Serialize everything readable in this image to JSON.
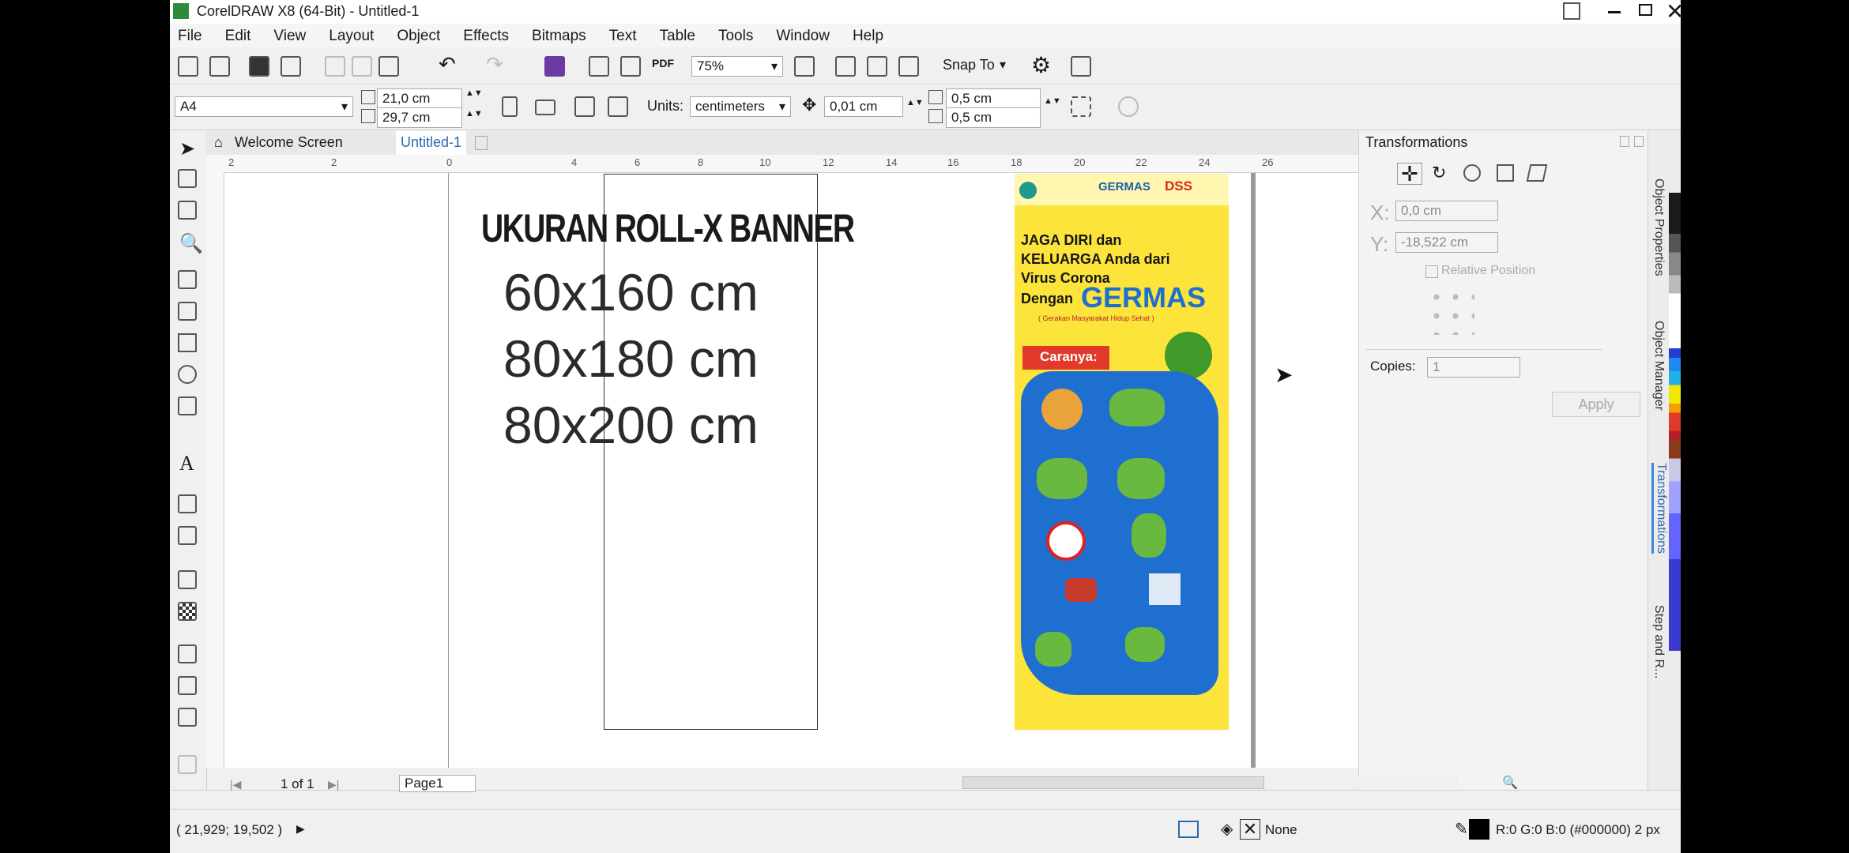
{
  "window": {
    "title": "CorelDRAW X8 (64-Bit) - Untitled-1"
  },
  "menu": [
    "File",
    "Edit",
    "View",
    "Layout",
    "Object",
    "Effects",
    "Bitmaps",
    "Text",
    "Table",
    "Tools",
    "Window",
    "Help"
  ],
  "toolbar": {
    "zoom": "75%",
    "snap": "Snap To",
    "pdf": "PDF"
  },
  "propbar": {
    "page_size": "A4",
    "width": "21,0 cm",
    "height": "29,7 cm",
    "units_label": "Units:",
    "units": "centimeters",
    "nudge": "0,01 cm",
    "dup_x": "0,5 cm",
    "dup_y": "0,5 cm"
  },
  "tabs": {
    "welcome": "Welcome Screen",
    "doc": "Untitled-1"
  },
  "ruler": {
    "ticks": [
      "2",
      "0",
      "2",
      "4",
      "6",
      "8",
      "10",
      "12",
      "14",
      "16",
      "18",
      "20",
      "22",
      "24",
      "26"
    ],
    "unit": "centimeters"
  },
  "canvas": {
    "heading": "UKURAN ROLL-X BANNER",
    "sizes": [
      "60x160 cm",
      "80x180 cm",
      "80x200 cm"
    ]
  },
  "banner": {
    "germas": "GERMAS",
    "dss": "DSS",
    "line1": "JAGA DIRI dan",
    "line2": "KELUARGA Anda dari",
    "line3": "Virus Corona",
    "line4": "Dengan",
    "big": "GERMAS",
    "sub": "( Gerakan Masyarakat Hidup Sehat )",
    "caranya": "Caranya:"
  },
  "panel": {
    "title": "Transformations",
    "x_label": "X:",
    "x_value": "0,0 cm",
    "y_label": "Y:",
    "y_value": "-18,522 cm",
    "relative": "Relative Position",
    "copies_label": "Copies:",
    "copies": "1",
    "apply": "Apply"
  },
  "dockers": [
    "Object Properties",
    "Object Manager",
    "Transformations",
    "Step and R..."
  ],
  "page_nav": {
    "count": "1 of 1",
    "page": "Page1"
  },
  "status": {
    "coords": "( 21,929; 19,502 )",
    "fill": "None",
    "outline": "R:0 G:0 B:0 (#000000)  2 px"
  },
  "colors": {
    "banner_yellow": "#fce43b",
    "banner_blue": "#1e6fd0",
    "germas_green": "#3f9a2a"
  }
}
